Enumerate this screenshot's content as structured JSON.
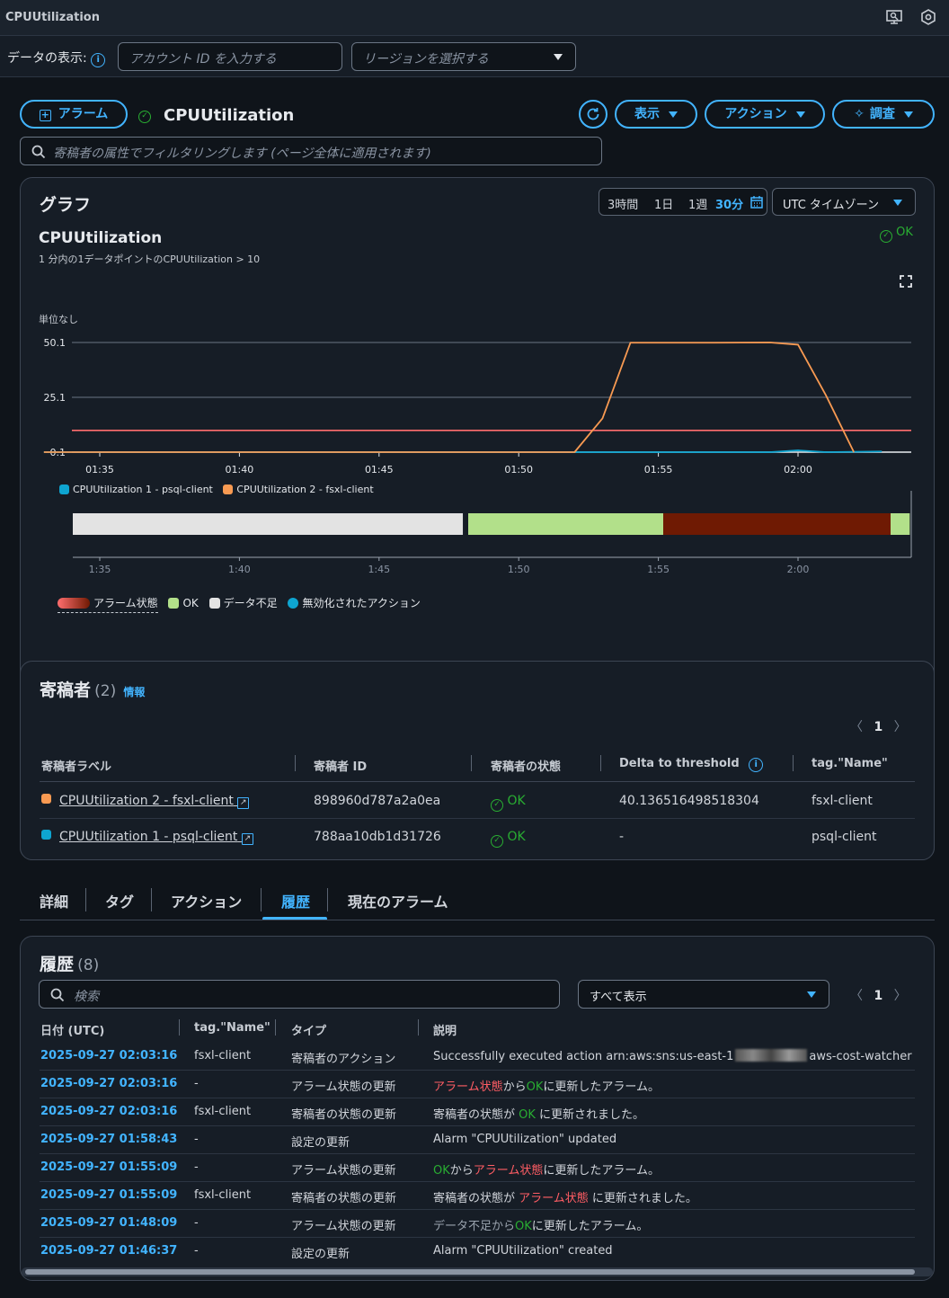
{
  "window": {
    "title": "CPUUtilization"
  },
  "databar": {
    "label": "データの表示:",
    "account_placeholder": "アカウント ID を入力する",
    "region_placeholder": "リージョンを選択する"
  },
  "header": {
    "alarm_btn": "アラーム",
    "alarm_name": "CPUUtilization",
    "view_btn": "表示",
    "action_btn": "アクション",
    "investigate_btn": "調査",
    "filter_placeholder": "寄稿者の属性でフィルタリングします (ページ全体に適用されます)"
  },
  "graph": {
    "heading": "グラフ",
    "ranges": [
      "3時間",
      "1日",
      "1週",
      "30分"
    ],
    "timezone": "UTC タイムゾーン",
    "chart_title": "CPUUtilization",
    "subtitle": "1 分内の1データポイントのCPUUtilization > 10",
    "status": "OK",
    "unit_label": "単位なし"
  },
  "chart_data": {
    "type": "line",
    "yticks": [
      "50.1",
      "25.1",
      "0.1"
    ],
    "ylim": [
      0.1,
      50.1
    ],
    "x_ticks": [
      "01:35",
      "01:40",
      "01:45",
      "01:50",
      "01:55",
      "02:00"
    ],
    "threshold": 10,
    "series": [
      {
        "name": "CPUUtilization 1 - psql-client",
        "color": "#0ea5d1",
        "x": [
          "01:33",
          "01:52",
          "01:57",
          "01:59",
          "02:00",
          "02:01",
          "02:03"
        ],
        "values": [
          0.1,
          0.1,
          0.1,
          0.1,
          0.9,
          0.1,
          0.4
        ]
      },
      {
        "name": "CPUUtilization 2 - fsxl-client",
        "color": "#f89a52",
        "x": [
          "01:33",
          "01:52",
          "01:53",
          "01:54",
          "01:57",
          "01:59",
          "02:00",
          "02:01",
          "02:02"
        ],
        "values": [
          0.1,
          0.1,
          15.5,
          50.0,
          50.0,
          50.1,
          49.1,
          26.0,
          0.1
        ]
      }
    ]
  },
  "state_bar": {
    "ticks": [
      "1:35",
      "1:40",
      "1:45",
      "1:50",
      "1:55",
      "2:00"
    ],
    "legend": [
      "アラーム状態",
      "OK",
      "データ不足",
      "無効化されたアクション"
    ],
    "colors": {
      "insufficient": "#e3e3e3",
      "ok": "#b2e08a",
      "alarm": "#6f1a03"
    }
  },
  "contributors": {
    "heading": "寄稿者",
    "count": "(2)",
    "info": "情報",
    "page": "1",
    "columns": [
      "寄稿者ラベル",
      "寄稿者 ID",
      "寄稿者の状態",
      "Delta to threshold",
      "tag.\"Name\""
    ],
    "rows": [
      {
        "label": "CPUUtilization 2 - fsxl-client",
        "id": "898960d787a2a0ea",
        "state": "OK",
        "delta": "40.136516498518304",
        "name": "fsxl-client",
        "color": "#f89a52"
      },
      {
        "label": "CPUUtilization 1 - psql-client",
        "id": "788aa10db1d31726",
        "state": "OK",
        "delta": "-",
        "name": "psql-client",
        "color": "#0ea5d1"
      }
    ]
  },
  "tabs": [
    "詳細",
    "タグ",
    "アクション",
    "履歴",
    "現在のアラーム"
  ],
  "history": {
    "heading": "履歴",
    "count": "(8)",
    "search_placeholder": "検索",
    "filter": "すべて表示",
    "page": "1",
    "columns": [
      "日付 (UTC)",
      "tag.\"Name\"",
      "タイプ",
      "説明"
    ],
    "rows": [
      {
        "date": "2025-09-27 02:03:16",
        "name": "fsxl-client",
        "type": "寄稿者のアクション",
        "desc": [
          "Successfully executed action arn:aws:sns:us-east-1",
          "aws-cost-watcher"
        ]
      },
      {
        "date": "2025-09-27 02:03:16",
        "name": "-",
        "type": "アラーム状態の更新",
        "desc": [
          "アラーム状態",
          "から",
          "OK",
          "に更新したアラーム。"
        ]
      },
      {
        "date": "2025-09-27 02:03:16",
        "name": "fsxl-client",
        "type": "寄稿者の状態の更新",
        "desc": [
          "寄稿者の状態が ",
          "OK",
          " に更新されました。"
        ]
      },
      {
        "date": "2025-09-27 01:58:43",
        "name": "-",
        "type": "設定の更新",
        "desc": [
          "Alarm \"CPUUtilization\" updated"
        ]
      },
      {
        "date": "2025-09-27 01:55:09",
        "name": "-",
        "type": "アラーム状態の更新",
        "desc": [
          "OK",
          "から",
          "アラーム状態",
          "に更新したアラーム。"
        ]
      },
      {
        "date": "2025-09-27 01:55:09",
        "name": "fsxl-client",
        "type": "寄稿者の状態の更新",
        "desc": [
          "寄稿者の状態が ",
          "アラーム状態",
          " に更新されました。"
        ]
      },
      {
        "date": "2025-09-27 01:48:09",
        "name": "-",
        "type": "アラーム状態の更新",
        "desc": [
          "データ不足から",
          "OK",
          "に更新したアラーム。"
        ]
      },
      {
        "date": "2025-09-27 01:46:37",
        "name": "-",
        "type": "設定の更新",
        "desc": [
          "Alarm \"CPUUtilization\" created"
        ]
      }
    ]
  }
}
